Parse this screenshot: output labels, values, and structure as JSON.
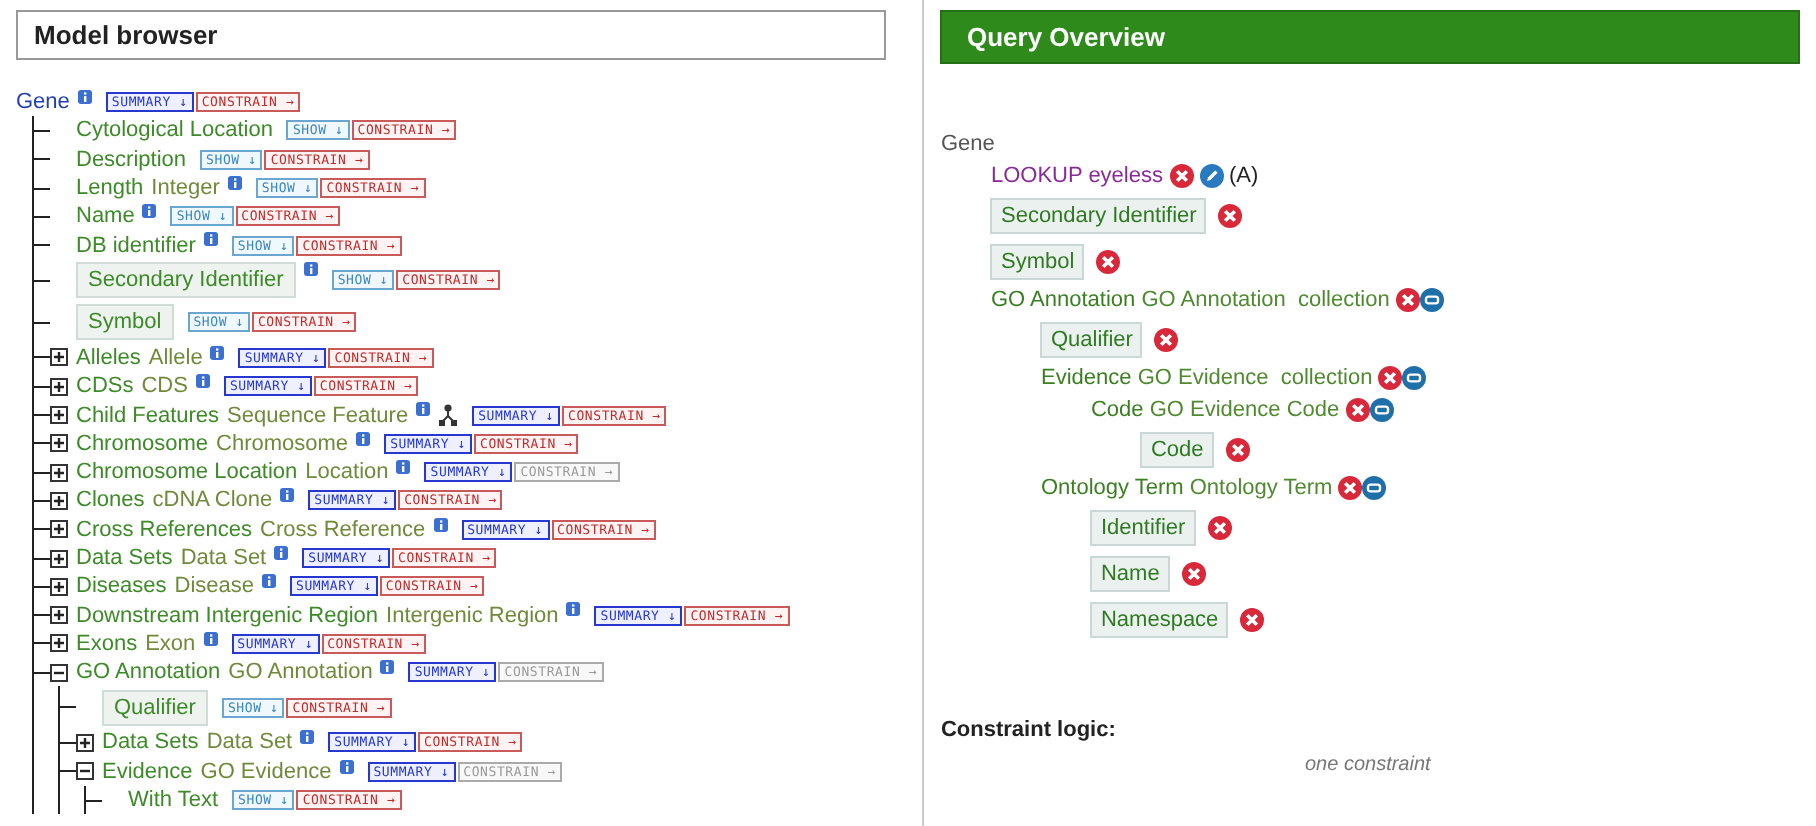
{
  "model_browser": {
    "title": "Model browser",
    "tree": {
      "name": "Gene",
      "info": true,
      "view": "SUMMARY ↓",
      "constrain": "CONSTRAIN →",
      "constrain_disabled": false,
      "children": [
        {
          "kind": "attribute",
          "name": "Cytological Location",
          "info": false,
          "in_query": false,
          "view": "SHOW ↓",
          "constrain": "CONSTRAIN →",
          "constrain_disabled": false
        },
        {
          "kind": "attribute",
          "name": "Description",
          "info": false,
          "in_query": false,
          "view": "SHOW ↓",
          "constrain": "CONSTRAIN →",
          "constrain_disabled": false
        },
        {
          "kind": "attribute",
          "name": "Length",
          "type": "Integer",
          "info": true,
          "in_query": false,
          "view": "SHOW ↓",
          "constrain": "CONSTRAIN →",
          "constrain_disabled": false
        },
        {
          "kind": "attribute",
          "name": "Name",
          "info": true,
          "in_query": false,
          "view": "SHOW ↓",
          "constrain": "CONSTRAIN →",
          "constrain_disabled": false
        },
        {
          "kind": "attribute",
          "name": "DB identifier",
          "info": true,
          "in_query": false,
          "view": "SHOW ↓",
          "constrain": "CONSTRAIN →",
          "constrain_disabled": false
        },
        {
          "kind": "attribute",
          "name": "Secondary Identifier",
          "info": true,
          "in_query": true,
          "view": "SHOW ↓",
          "constrain": "CONSTRAIN →",
          "constrain_disabled": false
        },
        {
          "kind": "attribute",
          "name": "Symbol",
          "info": false,
          "in_query": true,
          "view": "SHOW ↓",
          "constrain": "CONSTRAIN →",
          "constrain_disabled": false
        },
        {
          "kind": "reference",
          "name": "Alleles",
          "type": "Allele",
          "info": true,
          "expanded": false,
          "view": "SUMMARY ↓",
          "constrain": "CONSTRAIN →",
          "constrain_disabled": false
        },
        {
          "kind": "reference",
          "name": "CDSs",
          "type": "CDS",
          "info": true,
          "expanded": false,
          "view": "SUMMARY ↓",
          "constrain": "CONSTRAIN →",
          "constrain_disabled": false
        },
        {
          "kind": "reference",
          "name": "Child Features",
          "type": "Sequence Feature",
          "info": true,
          "graph_icon": true,
          "expanded": false,
          "view": "SUMMARY ↓",
          "constrain": "CONSTRAIN →",
          "constrain_disabled": false
        },
        {
          "kind": "reference",
          "name": "Chromosome",
          "type": "Chromosome",
          "info": true,
          "expanded": false,
          "view": "SUMMARY ↓",
          "constrain": "CONSTRAIN →",
          "constrain_disabled": false
        },
        {
          "kind": "reference",
          "name": "Chromosome Location",
          "type": "Location",
          "info": true,
          "expanded": false,
          "view": "SUMMARY ↓",
          "constrain": "CONSTRAIN →",
          "constrain_disabled": true
        },
        {
          "kind": "reference",
          "name": "Clones",
          "type": "cDNA Clone",
          "info": true,
          "expanded": false,
          "view": "SUMMARY ↓",
          "constrain": "CONSTRAIN →",
          "constrain_disabled": false
        },
        {
          "kind": "reference",
          "name": "Cross References",
          "type": "Cross Reference",
          "info": true,
          "expanded": false,
          "view": "SUMMARY ↓",
          "constrain": "CONSTRAIN →",
          "constrain_disabled": false
        },
        {
          "kind": "reference",
          "name": "Data Sets",
          "type": "Data Set",
          "info": true,
          "expanded": false,
          "view": "SUMMARY ↓",
          "constrain": "CONSTRAIN →",
          "constrain_disabled": false
        },
        {
          "kind": "reference",
          "name": "Diseases",
          "type": "Disease",
          "info": true,
          "expanded": false,
          "view": "SUMMARY ↓",
          "constrain": "CONSTRAIN →",
          "constrain_disabled": false
        },
        {
          "kind": "reference",
          "name": "Downstream Intergenic Region",
          "type": "Intergenic Region",
          "info": true,
          "expanded": false,
          "view": "SUMMARY ↓",
          "constrain": "CONSTRAIN →",
          "constrain_disabled": false
        },
        {
          "kind": "reference",
          "name": "Exons",
          "type": "Exon",
          "info": true,
          "expanded": false,
          "view": "SUMMARY ↓",
          "constrain": "CONSTRAIN →",
          "constrain_disabled": false
        },
        {
          "kind": "reference",
          "name": "GO Annotation",
          "type": "GO Annotation",
          "info": true,
          "expanded": true,
          "view": "SUMMARY ↓",
          "constrain": "CONSTRAIN →",
          "constrain_disabled": true,
          "children": [
            {
              "kind": "attribute",
              "name": "Qualifier",
              "info": false,
              "in_query": true,
              "view": "SHOW ↓",
              "constrain": "CONSTRAIN →",
              "constrain_disabled": false
            },
            {
              "kind": "reference",
              "name": "Data Sets",
              "type": "Data Set",
              "info": true,
              "expanded": false,
              "view": "SUMMARY ↓",
              "constrain": "CONSTRAIN →",
              "constrain_disabled": false
            },
            {
              "kind": "reference",
              "name": "Evidence",
              "type": "GO Evidence",
              "info": true,
              "expanded": true,
              "view": "SUMMARY ↓",
              "constrain": "CONSTRAIN →",
              "constrain_disabled": true,
              "children": [
                {
                  "kind": "attribute",
                  "name": "With Text",
                  "info": false,
                  "in_query": false,
                  "view": "SHOW ↓",
                  "constrain": "CONSTRAIN →",
                  "constrain_disabled": false
                }
              ]
            }
          ]
        }
      ]
    }
  },
  "query_overview": {
    "title": "Query Overview",
    "root": {
      "label": "Gene",
      "children": [
        {
          "kind": "constraint",
          "text": "LOOKUP eyeless",
          "code": "(A)"
        },
        {
          "kind": "field",
          "label": "Secondary Identifier"
        },
        {
          "kind": "field",
          "label": "Symbol"
        },
        {
          "kind": "reference",
          "name": "GO Annotation",
          "type": "GO Annotation",
          "suffix": "collection",
          "children": [
            {
              "kind": "field",
              "label": "Qualifier"
            },
            {
              "kind": "reference",
              "name": "Evidence",
              "type": "GO Evidence",
              "suffix": "collection",
              "children": [
                {
                  "kind": "reference",
                  "name": "Code",
                  "type": "GO Evidence Code",
                  "children": [
                    {
                      "kind": "field",
                      "label": "Code"
                    }
                  ]
                }
              ]
            },
            {
              "kind": "reference",
              "name": "Ontology Term",
              "type": "Ontology Term",
              "children": [
                {
                  "kind": "field",
                  "label": "Identifier"
                },
                {
                  "kind": "field",
                  "label": "Name"
                },
                {
                  "kind": "field",
                  "label": "Namespace"
                }
              ]
            }
          ]
        }
      ]
    },
    "constraint_logic": {
      "title": "Constraint logic:",
      "text": "one constraint"
    }
  }
}
